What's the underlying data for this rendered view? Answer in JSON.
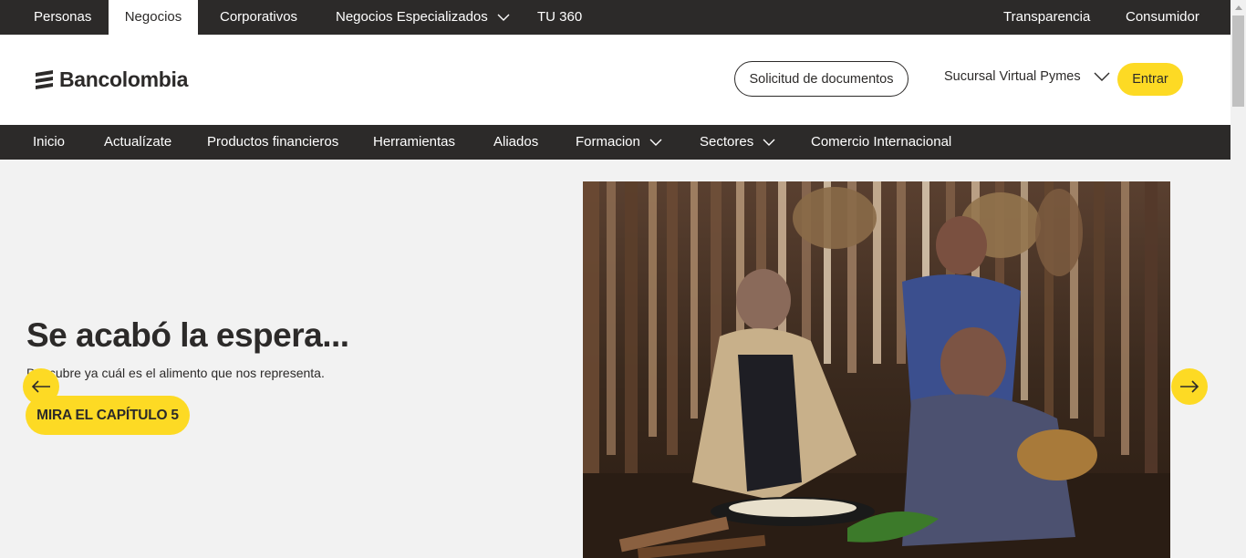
{
  "topbar": {
    "left_items": [
      "Personas",
      "Negocios",
      "Corporativos",
      "Negocios Especializados",
      "TU 360"
    ],
    "active": "Negocios",
    "right_items": [
      "Transparencia",
      "Consumidor"
    ]
  },
  "header": {
    "logo_text": "Bancolombia",
    "docs_button": "Solicitud de documentos",
    "sucursal": "Sucursal Virtual Pymes",
    "entrar_button": "Entrar"
  },
  "nav": {
    "items": [
      "Inicio",
      "Actualízate",
      "Productos financieros",
      "Herramientas",
      "Aliados",
      "Formacion",
      "Sectores",
      "Comercio Internacional"
    ]
  },
  "hero": {
    "title": "Se acabó la espera...",
    "subtitle": "Descubre ya cuál es el alimento que nos representa.",
    "cta": "MIRA EL CAPÍTULO 5"
  },
  "colors": {
    "brand_yellow": "#fdda24",
    "dark": "#2c2a29",
    "bg": "#f2f2f2"
  },
  "icons": {
    "prev": "arrow-left-icon",
    "next": "arrow-right-icon",
    "dropdown": "chevron-down-icon"
  }
}
